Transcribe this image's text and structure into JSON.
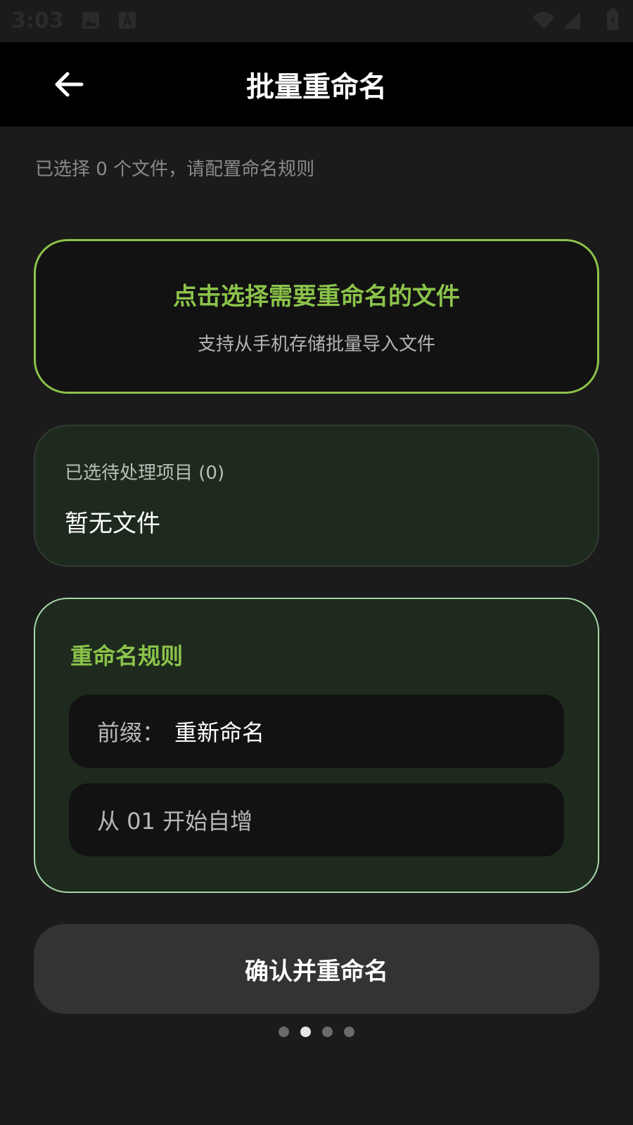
{
  "status_bar": {
    "time": "3:03",
    "icons": [
      "image-icon",
      "a-icon",
      "wifi-icon",
      "signal-icon",
      "battery-icon"
    ]
  },
  "app_bar": {
    "title": "批量重命名",
    "back_icon": "arrow-left-icon"
  },
  "subtitle": "已选择 0 个文件，请配置命名规则",
  "pick_card": {
    "title": "点击选择需要重命名的文件",
    "subtitle": "支持从手机存储批量导入文件"
  },
  "selected": {
    "label": "已选待处理项目 (0)",
    "empty_text": "暂无文件"
  },
  "rules": {
    "title": "重命名规则",
    "prefix_label": "前缀：",
    "prefix_value": "重新命名",
    "sequence_text": "从 01 开始自增"
  },
  "confirm_button": "确认并重命名",
  "pager": {
    "count": 4,
    "active_index": 1
  },
  "colors": {
    "background": "#1b1b1b",
    "app_bar": "#000000",
    "accent_green": "#8bc34a",
    "light_green_border": "#a5d6a7",
    "card_green": "#1d2a1d",
    "field_bg": "#121212",
    "button_bg": "#333333"
  }
}
